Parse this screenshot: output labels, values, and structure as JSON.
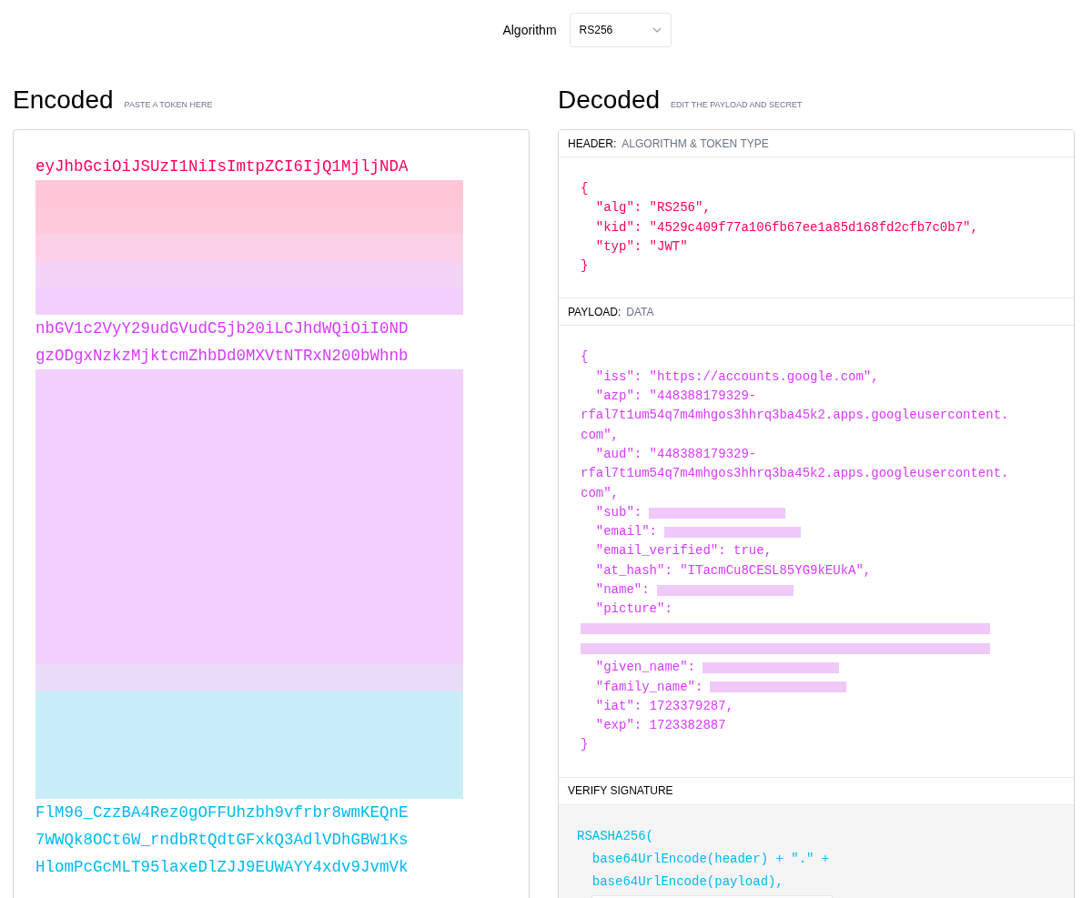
{
  "algorithm": {
    "label": "Algorithm",
    "value": "RS256"
  },
  "encoded": {
    "title": "Encoded",
    "hint": "PASTE A TOKEN HERE",
    "segments": [
      {
        "kind": "text",
        "color": "#fb015b",
        "text": "eyJhbGciOiJSUzI1NiIsImtpZCI6IjQ1MjljNDA"
      },
      {
        "kind": "redacted",
        "rows": [
          {
            "color": "#ffc6d8"
          },
          {
            "color": "#ffcbdc"
          },
          {
            "color": "#fcd0e6"
          },
          {
            "color": "#f5d3f7"
          },
          {
            "color": "#f3d0fc"
          }
        ]
      },
      {
        "kind": "text",
        "color": "#d63aff",
        "text": "nbGV1c2VyY29udGVudC5jb20iLCJhdWQiOiI0ND"
      },
      {
        "kind": "text",
        "color": "#d63aff",
        "text": "gzODgxNzkzMjktcmZhbDd0MXVtNTRxN200bWhnb"
      },
      {
        "kind": "redacted",
        "rows": [
          {
            "color": "#f3d0fc"
          },
          {
            "color": "#f3d0fc"
          },
          {
            "color": "#f3d0fc"
          },
          {
            "color": "#f3d0fc"
          },
          {
            "color": "#f3d0fc"
          },
          {
            "color": "#f3d0fc"
          },
          {
            "color": "#f3d0fc"
          },
          {
            "color": "#f3d0fc"
          },
          {
            "color": "#f3d0fc"
          },
          {
            "color": "#f3d0fc"
          },
          {
            "color": "#f3d0fc"
          },
          {
            "color": "#e8dcf8"
          },
          {
            "color": "#c9ecf9"
          },
          {
            "color": "#c9ecf9"
          },
          {
            "color": "#c9ecf9"
          },
          {
            "color": "#c9ecf9"
          }
        ]
      },
      {
        "kind": "text",
        "color": "#00b9f1",
        "text": "FlM96_CzzBA4Rez0gOFFUhzbh9vfrbr8wmKEQnE"
      },
      {
        "kind": "text",
        "color": "#00b9f1",
        "text": "7WWQk8OCt6W_rndbRtQdtGFxkQ3AdlVDhGBW1Ks"
      },
      {
        "kind": "text",
        "color": "#00b9f1",
        "text": "HlomPcGcMLT95laxeDlZJJ9EUWAYY4xdv9JvmVk"
      }
    ]
  },
  "decoded": {
    "title": "Decoded",
    "hint": "EDIT THE PAYLOAD AND SECRET",
    "header": {
      "label": "HEADER:",
      "sublabel": "ALGORITHM & TOKEN TYPE",
      "color": "#fb015b",
      "lines": [
        {
          "kind": "text",
          "text": "{"
        },
        {
          "kind": "text",
          "text": "  \"alg\": \"RS256\","
        },
        {
          "kind": "text",
          "text": "  \"kid\": \"4529c409f77a106fb67ee1a85d168fd2cfb7c0b7\","
        },
        {
          "kind": "text",
          "text": "  \"typ\": \"JWT\""
        },
        {
          "kind": "text",
          "text": "}"
        }
      ]
    },
    "payload": {
      "label": "PAYLOAD:",
      "sublabel": "DATA",
      "color": "#d63aff",
      "lines": [
        {
          "kind": "text",
          "text": "{"
        },
        {
          "kind": "text",
          "text": "  \"iss\": \"https://accounts.google.com\","
        },
        {
          "kind": "text",
          "text": "  \"azp\": \"448388179329-"
        },
        {
          "kind": "text",
          "text": "rfal7t1um54q7m4mhgos3hhrq3ba45k2.apps.googleusercontent."
        },
        {
          "kind": "text",
          "text": "com\","
        },
        {
          "kind": "text",
          "text": "  \"aud\": \"448388179329-"
        },
        {
          "kind": "text",
          "text": "rfal7t1um54q7m4mhgos3hhrq3ba45k2.apps.googleusercontent."
        },
        {
          "kind": "text",
          "text": "com\","
        },
        {
          "kind": "redacted_value",
          "text": "  \"sub\":"
        },
        {
          "kind": "redacted_value",
          "text": "  \"email\":"
        },
        {
          "kind": "text",
          "text": "  \"email_verified\": true,"
        },
        {
          "kind": "text",
          "text": "  \"at_hash\": \"ITacmCu8CESL85YG9kEUkA\","
        },
        {
          "kind": "redacted_value",
          "text": "  \"name\":"
        },
        {
          "kind": "text",
          "text": "  \"picture\":"
        },
        {
          "kind": "redacted_line"
        },
        {
          "kind": "redacted_line"
        },
        {
          "kind": "redacted_value",
          "text": "  \"given_name\":"
        },
        {
          "kind": "redacted_value",
          "text": "  \"family_name\":"
        },
        {
          "kind": "text",
          "text": "  \"iat\": 1723379287,"
        },
        {
          "kind": "text",
          "text": "  \"exp\": 1723382887"
        },
        {
          "kind": "text",
          "text": "}"
        }
      ]
    },
    "signature": {
      "label": "VERIFY SIGNATURE",
      "color": "#00b9f1",
      "lines": [
        "RSASHA256(",
        "  base64UrlEncode(header) + \".\" +",
        "  base64UrlEncode(payload),"
      ]
    }
  }
}
